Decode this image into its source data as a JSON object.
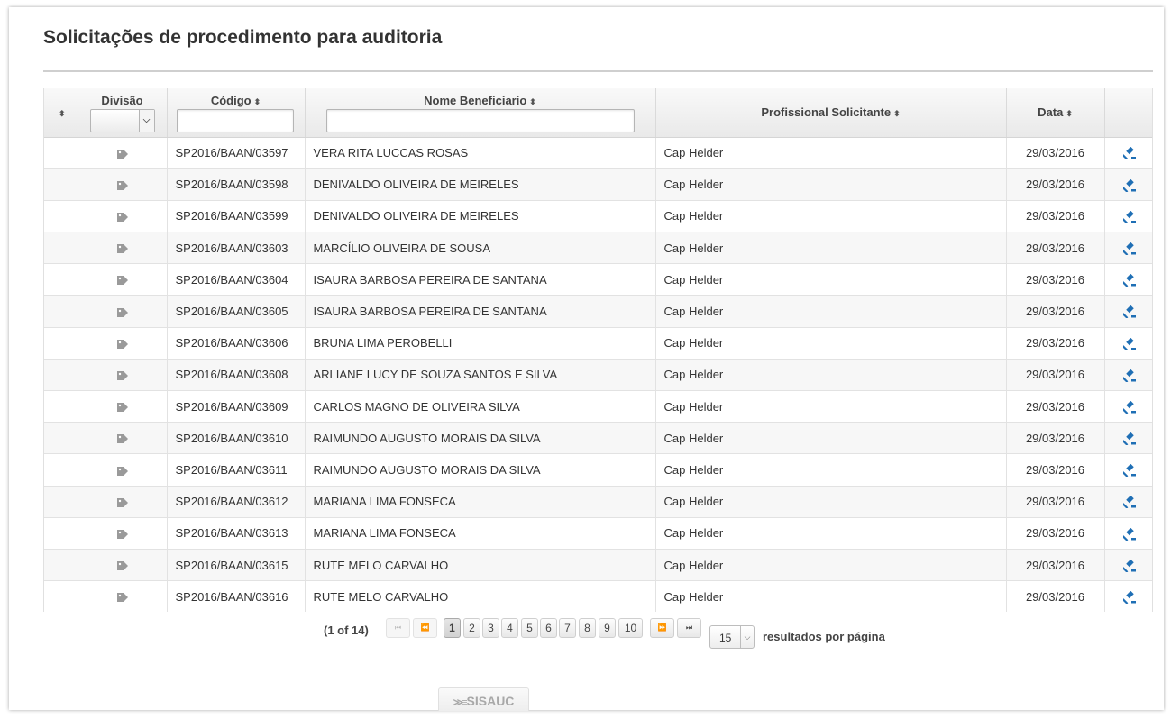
{
  "page": {
    "title": "Solicitações de procedimento para auditoria"
  },
  "table": {
    "headers": {
      "sort_all": "⬍",
      "divisao": "Divisão",
      "codigo": "Código",
      "nome": "Nome Beneficiario",
      "profissional": "Profissional Solicitante",
      "data": "Data"
    },
    "sort_glyph": "⬍",
    "rows": [
      {
        "codigo": "SP2016/BAAN/03597",
        "nome": "VERA RITA LUCCAS ROSAS",
        "profissional": "Cap Helder",
        "data": "29/03/2016"
      },
      {
        "codigo": "SP2016/BAAN/03598",
        "nome": "DENIVALDO OLIVEIRA DE MEIRELES",
        "profissional": "Cap Helder",
        "data": "29/03/2016"
      },
      {
        "codigo": "SP2016/BAAN/03599",
        "nome": "DENIVALDO OLIVEIRA DE MEIRELES",
        "profissional": "Cap Helder",
        "data": "29/03/2016"
      },
      {
        "codigo": "SP2016/BAAN/03603",
        "nome": "MARCÍLIO OLIVEIRA DE SOUSA",
        "profissional": "Cap Helder",
        "data": "29/03/2016"
      },
      {
        "codigo": "SP2016/BAAN/03604",
        "nome": "ISAURA BARBOSA PEREIRA DE SANTANA",
        "profissional": "Cap Helder",
        "data": "29/03/2016"
      },
      {
        "codigo": "SP2016/BAAN/03605",
        "nome": "ISAURA BARBOSA PEREIRA DE SANTANA",
        "profissional": "Cap Helder",
        "data": "29/03/2016"
      },
      {
        "codigo": "SP2016/BAAN/03606",
        "nome": "BRUNA LIMA PEROBELLI",
        "profissional": "Cap Helder",
        "data": "29/03/2016"
      },
      {
        "codigo": "SP2016/BAAN/03608",
        "nome": "ARLIANE LUCY DE SOUZA SANTOS E SILVA",
        "profissional": "Cap Helder",
        "data": "29/03/2016"
      },
      {
        "codigo": "SP2016/BAAN/03609",
        "nome": "CARLOS MAGNO DE OLIVEIRA SILVA",
        "profissional": "Cap Helder",
        "data": "29/03/2016"
      },
      {
        "codigo": "SP2016/BAAN/03610",
        "nome": "RAIMUNDO AUGUSTO MORAIS DA SILVA",
        "profissional": "Cap Helder",
        "data": "29/03/2016"
      },
      {
        "codigo": "SP2016/BAAN/03611",
        "nome": "RAIMUNDO AUGUSTO MORAIS DA SILVA",
        "profissional": "Cap Helder",
        "data": "29/03/2016"
      },
      {
        "codigo": "SP2016/BAAN/03612",
        "nome": "MARIANA LIMA FONSECA",
        "profissional": "Cap Helder",
        "data": "29/03/2016"
      },
      {
        "codigo": "SP2016/BAAN/03613",
        "nome": "MARIANA LIMA FONSECA",
        "profissional": "Cap Helder",
        "data": "29/03/2016"
      },
      {
        "codigo": "SP2016/BAAN/03615",
        "nome": "RUTE MELO CARVALHO",
        "profissional": "Cap Helder",
        "data": "29/03/2016"
      },
      {
        "codigo": "SP2016/BAAN/03616",
        "nome": "RUTE MELO CARVALHO",
        "profissional": "Cap Helder",
        "data": "29/03/2016"
      }
    ],
    "row_icons": {
      "divisao": "tag-icon",
      "action": "gavel-icon"
    },
    "action_color": "#1f6fb5",
    "tag_color": "#9a9a9a"
  },
  "pagination": {
    "count_text": "(1 of 14)",
    "first": "◂◂",
    "prev": "◂◂",
    "pages": [
      "1",
      "2",
      "3",
      "4",
      "5",
      "6",
      "7",
      "8",
      "9",
      "10"
    ],
    "current_page": "1",
    "next": "▸▸",
    "last": "▸▸",
    "rows_per_page": "15",
    "rows_per_page_label": "resultados por página"
  },
  "footer": {
    "logo_text": "SISAUC"
  }
}
